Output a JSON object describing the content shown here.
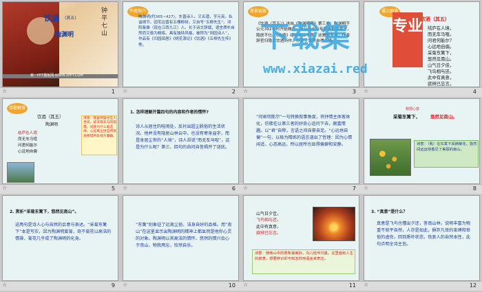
{
  "slides": [
    {
      "num": "1",
      "title": "饮酒",
      "subtitle": "(其五)",
      "author": "陶渊明",
      "footer": "第一PPT模板网-WWW.1PPT.COM"
    },
    {
      "num": "2",
      "tag": "作者简介",
      "body": "陶渊明(约365~427)，东晋诗人。又名潜，字元亮。私谥靖节。因宅边曾有五棵柳树，又自号“五柳先生”。浔阳柴桑（现在江西九江）人。长于诗文辞赋，语言质朴自然而又极为精练。具有独特风格，被称为“田园诗人”，作品有《归园田居》《桃花源记》《饮酒》《五柳先生传》等。"
    },
    {
      "num": "3",
      "tag": "背景链接",
      "body": "《饮酒（其五）》选自《陶渊明集》第三卷。陶渊明于公元392年时开始做官，至公元405年辞去彭泽县令，隐居不仕。《饮酒》组诗共二十首，这是第五首。作者辞官归隐后饮酒所作，抒发了悠然自得之情。"
    },
    {
      "num": "4",
      "tag": "课文朗读",
      "title": "饮酒（其五）",
      "lines": [
        "结庐在人境，",
        "而无车马喧。",
        "问君何能尔？",
        "心远地自偏。",
        "采菊东篱下，",
        "悠然见南山。",
        "山气日夕佳，",
        "飞鸟相与还。",
        "此中有真意，",
        "欲辨已忘言。"
      ]
    },
    {
      "num": "5",
      "tag": "诗歌解读",
      "title": "饮酒（其五）",
      "author": "陶渊明",
      "note": "诗意：我虽然居住在人世间，却没有车马的喧嚣。问我为什么能这样，心远离尘世自然就会觉得所处地方偏僻。",
      "keys": [
        "结庐在人境",
        "而无车马喧",
        "问君何能尔",
        "心远地自偏"
      ]
    },
    {
      "num": "6",
      "heading": "1. 怎样理解开篇四句的内容和作者的情怀?",
      "body": "诗人从居住的喧闹处，反衬出超尘脱俗的生活状况。他并没有隐居山林云中，也没有寄身庙宇，而是身居尘世的“人境”，诗人却说“而无车马喧”，这是为什么呢？第三、四句的自问自答揭开了谜底。"
    },
    {
      "num": "7",
      "body": "“问君何能尔”一句转换叙事角度，将抒情主体客体化，仿佛在以第三者的好奇心追问下去，颇富情趣。以“君”自称，言语之间自豪自足。“心远地自偏”一句，以极为精练的语言道出了哲理：因为心情闲适，心态高远，所以居所也显得偏僻和安静。"
    },
    {
      "num": "8",
      "lines": [
        "采菊东篱下，",
        "悠然见南山。"
      ],
      "note": "诗意：（我）在东篱下采摘菊花，悠然间远远地看见了美丽的南山。",
      "annot": "我把心放"
    },
    {
      "num": "9",
      "heading": "2. 赏析“采菊东篱下，悠然见南山”。",
      "body": "这两句是诗人心与自然的会意与表述。“采菊东篱下”本是写实，因为陶渊明爱菊，奇不菊花以高洁的情操，菊花几乎成了陶渊明的化身。"
    },
    {
      "num": "10",
      "body": "“东篱”则象征了远离尘俗、洁身自好的品格。而“南山”在这里显示出陶渊明的精神上都显然是他你心灵的对象。陶渊明以其高洁的情怀、悠然的情兴会心于南山，物我两忘，恰然自乐。"
    },
    {
      "num": "11",
      "lines": [
        "山气日夕佳，",
        "飞鸟相与还。",
        "此中有真意，",
        "欲辨已忘言。"
      ],
      "note": "诗意：傍晚山中的景象最美好，鸟儿结伴归巢。这里面有人生的真意，想要辨识却不知怎样用语言来表达。"
    },
    {
      "num": "12",
      "heading": "3. “真意”是什么？",
      "body": "真意是飞鸟也懂出夕还，答南山林，说明丰富为物重不就平自然，人亦是如此，摒弃凡世的束缚和世俗的虚伪，回到质朴状态，恢复人的自然本性，此句点明全诗主旨。"
    }
  ],
  "watermark": {
    "main": "下载集",
    "url": "www.xiazai.red",
    "badge": "专业"
  },
  "colors": {
    "bg": "#c9c9c9",
    "accent": "#e8a52a",
    "blue": "#1d3f9a",
    "red": "#d22222"
  }
}
